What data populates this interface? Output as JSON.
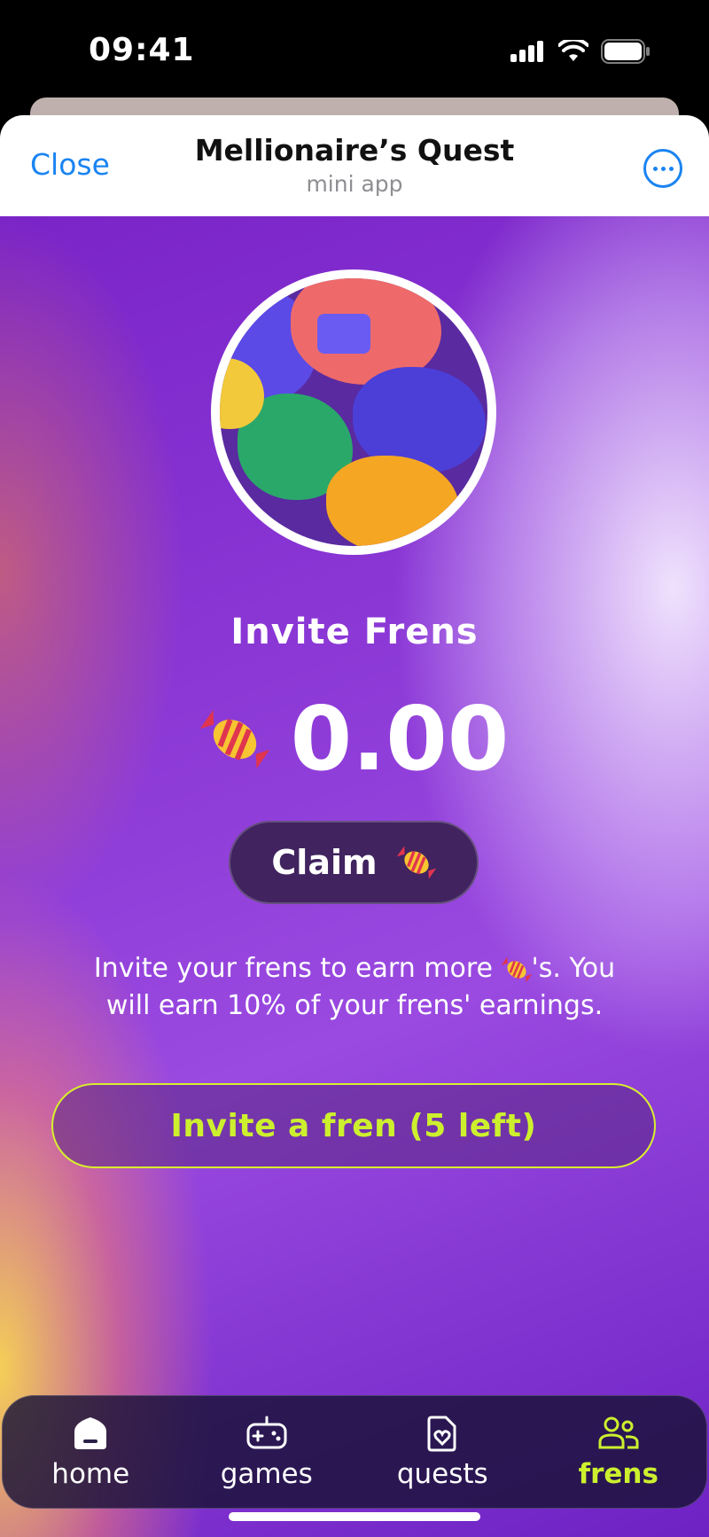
{
  "status": {
    "time": "09:41"
  },
  "header": {
    "close_label": "Close",
    "title": "Mellionaire’s Quest",
    "subtitle": "mini app"
  },
  "main": {
    "section_title": "Invite Frens",
    "balance": "0.00",
    "claim_label": "Claim",
    "invite_desc_before": "Invite your frens to earn more ",
    "invite_desc_after": "'s. You will earn 10% of your frens' earnings.",
    "invite_button": "Invite a fren (5 left)"
  },
  "nav": [
    {
      "label": "home",
      "icon": "home-icon",
      "active": false
    },
    {
      "label": "games",
      "icon": "gamepad-icon",
      "active": false
    },
    {
      "label": "quests",
      "icon": "quests-icon",
      "active": false
    },
    {
      "label": "frens",
      "icon": "frens-icon",
      "active": true
    }
  ],
  "colors": {
    "accent": "#cdf02e",
    "link": "#1a84f2",
    "claim_bg": "#40235f"
  }
}
